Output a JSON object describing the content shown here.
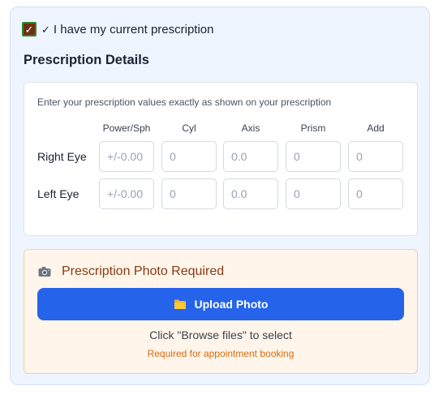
{
  "checkbox": {
    "checked": true,
    "label": "I have my current prescription",
    "label_prefix": "✓"
  },
  "section_title": "Prescription Details",
  "prescription": {
    "instructions": "Enter your prescription values exactly as shown on your prescription",
    "columns": [
      "Power/Sph",
      "Cyl",
      "Axis",
      "Prism",
      "Add"
    ],
    "rows": [
      {
        "label": "Right Eye",
        "placeholders": [
          "+/-0.00",
          "0",
          "0.0",
          "0",
          "0"
        ]
      },
      {
        "label": "Left Eye",
        "placeholders": [
          "+/-0.00",
          "0",
          "0.0",
          "0",
          "0"
        ]
      }
    ]
  },
  "photo": {
    "icon": "camera-icon",
    "title": "Prescription Photo Required",
    "upload_button": {
      "icon": "folder-icon",
      "label": "Upload Photo"
    },
    "hint": "Click \"Browse files\" to select",
    "required_note": "Required for appointment booking"
  },
  "colors": {
    "accent": "#2563eb",
    "warning_text": "#8a3a10",
    "required_text": "#d96a0e",
    "panel_bg": "#eff5fe",
    "photo_bg": "#fff5ea"
  }
}
